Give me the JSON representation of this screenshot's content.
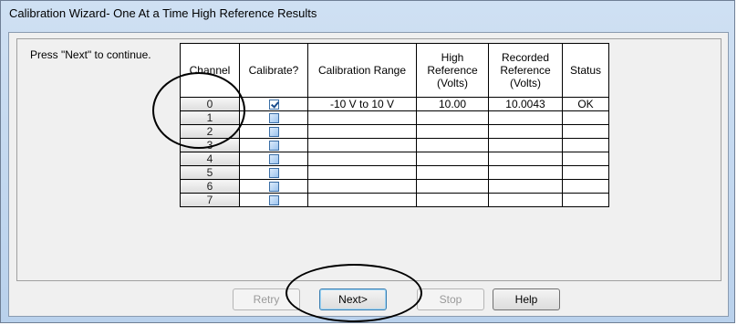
{
  "window": {
    "title": "Calibration Wizard- One At a Time High Reference Results"
  },
  "prompt": "Press \"Next\" to continue.",
  "table": {
    "headers": {
      "channel": "Channel",
      "calibrate": "Calibrate?",
      "range": "Calibration Range",
      "high_ref": "High Reference (Volts)",
      "recorded_ref": "Recorded Reference (Volts)",
      "status": "Status"
    },
    "rows": [
      {
        "channel": "0",
        "calibrate": true,
        "range": "-10 V to 10 V",
        "high_ref": "10.00",
        "recorded_ref": "10.0043",
        "status": "OK"
      },
      {
        "channel": "1",
        "calibrate": false,
        "range": "",
        "high_ref": "",
        "recorded_ref": "",
        "status": ""
      },
      {
        "channel": "2",
        "calibrate": false,
        "range": "",
        "high_ref": "",
        "recorded_ref": "",
        "status": ""
      },
      {
        "channel": "3",
        "calibrate": false,
        "range": "",
        "high_ref": "",
        "recorded_ref": "",
        "status": ""
      },
      {
        "channel": "4",
        "calibrate": false,
        "range": "",
        "high_ref": "",
        "recorded_ref": "",
        "status": ""
      },
      {
        "channel": "5",
        "calibrate": false,
        "range": "",
        "high_ref": "",
        "recorded_ref": "",
        "status": ""
      },
      {
        "channel": "6",
        "calibrate": false,
        "range": "",
        "high_ref": "",
        "recorded_ref": "",
        "status": ""
      },
      {
        "channel": "7",
        "calibrate": false,
        "range": "",
        "high_ref": "",
        "recorded_ref": "",
        "status": ""
      }
    ]
  },
  "buttons": {
    "retry": "Retry",
    "next": "Next>",
    "stop": "Stop",
    "help": "Help"
  }
}
